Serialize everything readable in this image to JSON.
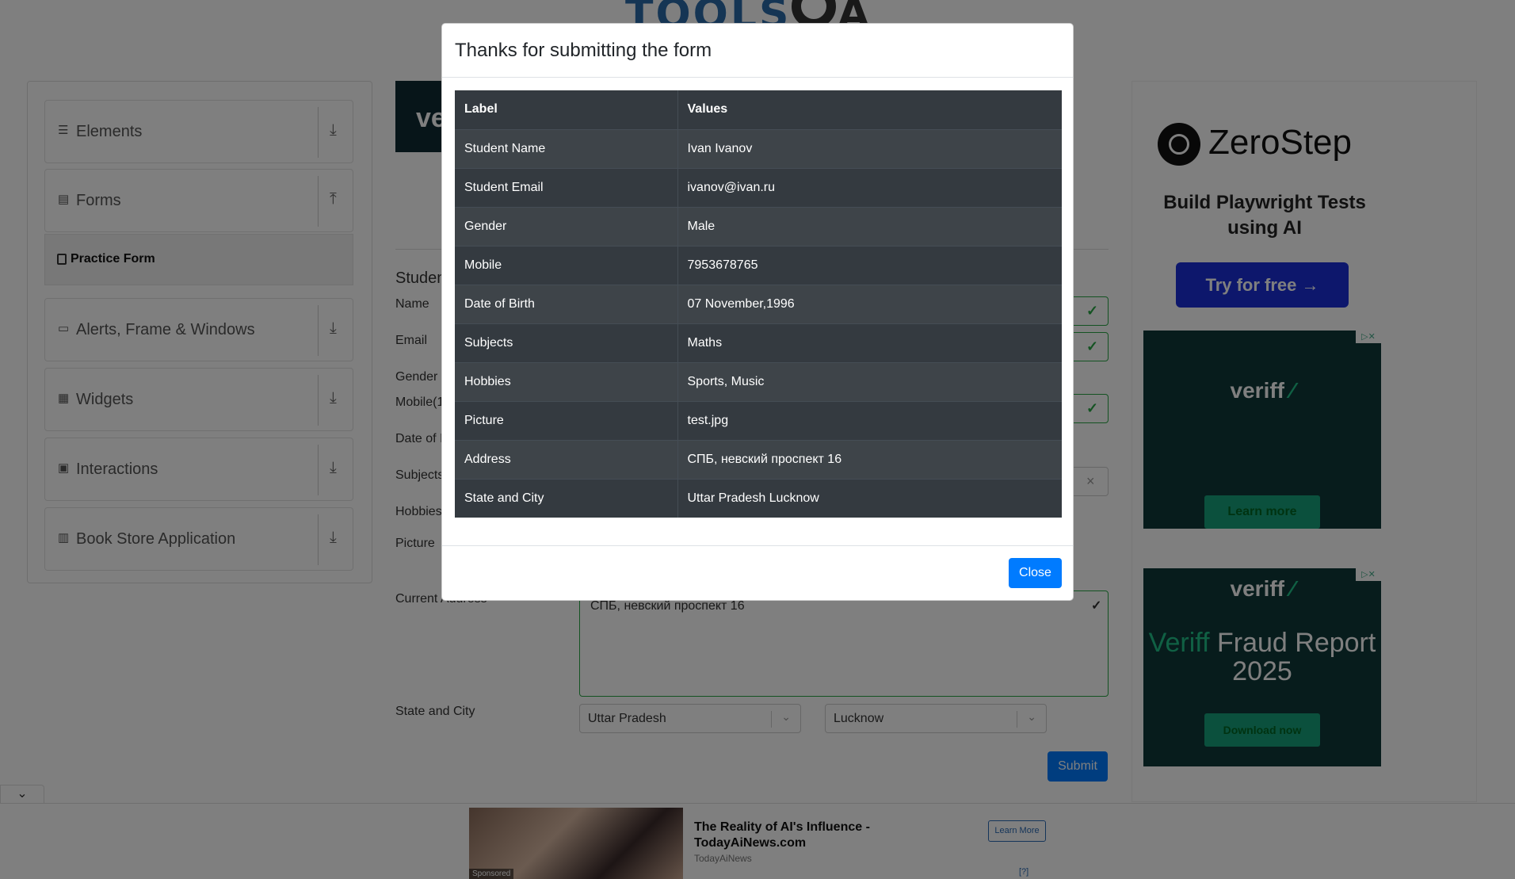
{
  "sidebar": {
    "groups": [
      {
        "label": "Elements",
        "icon": "hamburger-icon"
      },
      {
        "label": "Forms",
        "icon": "document-icon"
      },
      {
        "label": "Alerts, Frame & Windows",
        "icon": "window-icon"
      },
      {
        "label": "Widgets",
        "icon": "grid-icon"
      },
      {
        "label": "Interactions",
        "icon": "box-icon"
      },
      {
        "label": "Book Store Application",
        "icon": "books-icon"
      }
    ],
    "active_item": "Practice Form"
  },
  "form": {
    "heading": "Studen",
    "labels": {
      "name": "Name",
      "email": "Email",
      "gender": "Gender",
      "mobile": "Mobile(1",
      "dob": "Date of I",
      "subjects": "Subjects",
      "hobbies": "Hobbies",
      "picture": "Picture",
      "address": "Current Address",
      "state_city": "State and City"
    },
    "address_value": "СПБ, невский проспект 16",
    "state_value": "Uttar Pradesh",
    "city_value": "Lucknow",
    "submit_label": "Submit",
    "subjects_clear": "×"
  },
  "modal": {
    "title": "Thanks for submitting the form",
    "header": [
      "Label",
      "Values"
    ],
    "rows": [
      [
        "Student Name",
        "Ivan Ivanov"
      ],
      [
        "Student Email",
        "ivanov@ivan.ru"
      ],
      [
        "Gender",
        "Male"
      ],
      [
        "Mobile",
        "7953678765"
      ],
      [
        "Date of Birth",
        "07 November,1996"
      ],
      [
        "Subjects",
        "Maths"
      ],
      [
        "Hobbies",
        "Sports, Music"
      ],
      [
        "Picture",
        "test.jpg"
      ],
      [
        "Address",
        "СПБ, невский проспект 16"
      ],
      [
        "State and City",
        "Uttar Pradesh Lucknow"
      ]
    ],
    "close_label": "Close"
  },
  "ads": {
    "zerostep": {
      "name": "ZeroStep",
      "tagline": "Build Playwright Tests using AI",
      "cta": "Try for free →"
    },
    "veriff1": {
      "logo": "veriff",
      "cta": "Learn more"
    },
    "veriff2": {
      "logo": "veriff",
      "title_accent": "Veriff",
      "title": "Fraud Report 2025",
      "cta": "Download now"
    },
    "left_banner": "ve",
    "bottom": {
      "title": "The Reality of AI's Influence - TodayAiNews.com",
      "source": "TodayAiNews",
      "cta": "Learn More",
      "sponsored": "Sponsored",
      "info": "[?]"
    }
  }
}
